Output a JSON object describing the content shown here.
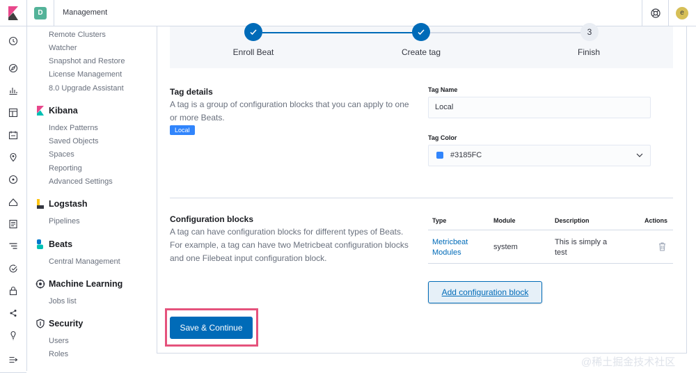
{
  "header": {
    "space_initial": "D",
    "breadcrumb": "Management",
    "user_initial": "e"
  },
  "sidebar": {
    "es_items": [
      "Remote Clusters",
      "Watcher",
      "Snapshot and Restore",
      "License Management",
      "8.0 Upgrade Assistant"
    ],
    "kibana": {
      "title": "Kibana",
      "items": [
        "Index Patterns",
        "Saved Objects",
        "Spaces",
        "Reporting",
        "Advanced Settings"
      ]
    },
    "logstash": {
      "title": "Logstash",
      "items": [
        "Pipelines"
      ]
    },
    "beats": {
      "title": "Beats",
      "items": [
        "Central Management"
      ]
    },
    "ml": {
      "title": "Machine Learning",
      "items": [
        "Jobs list"
      ]
    },
    "security": {
      "title": "Security",
      "items": [
        "Users",
        "Roles"
      ]
    }
  },
  "steps": [
    {
      "label": "Enroll Beat",
      "status": "complete"
    },
    {
      "label": "Create tag",
      "status": "complete"
    },
    {
      "label": "Finish",
      "number": "3",
      "status": "incomplete"
    }
  ],
  "tag_details": {
    "title": "Tag details",
    "description": "A tag is a group of configuration blocks that you can apply to one or more Beats.",
    "badge": "Local",
    "name_label": "Tag Name",
    "name_value": "Local",
    "color_label": "Tag Color",
    "color_value": "#3185FC",
    "color_hex": "#3185fc"
  },
  "config_blocks": {
    "title": "Configuration blocks",
    "description": "A tag can have configuration blocks for different types of Beats. For example, a tag can have two Metricbeat configuration blocks and one Filebeat input configuration block.",
    "columns": [
      "Type",
      "Module",
      "Description",
      "Actions"
    ],
    "rows": [
      {
        "type": "Metricbeat Modules",
        "module": "system",
        "description": "This is simply a test"
      }
    ],
    "add_button": "Add configuration block"
  },
  "save_button": "Save & Continue",
  "watermark": "@稀土掘金技术社区",
  "colors": {
    "primary": "#006bb8",
    "highlight": "#e5527c",
    "tag": "#3185fc"
  }
}
